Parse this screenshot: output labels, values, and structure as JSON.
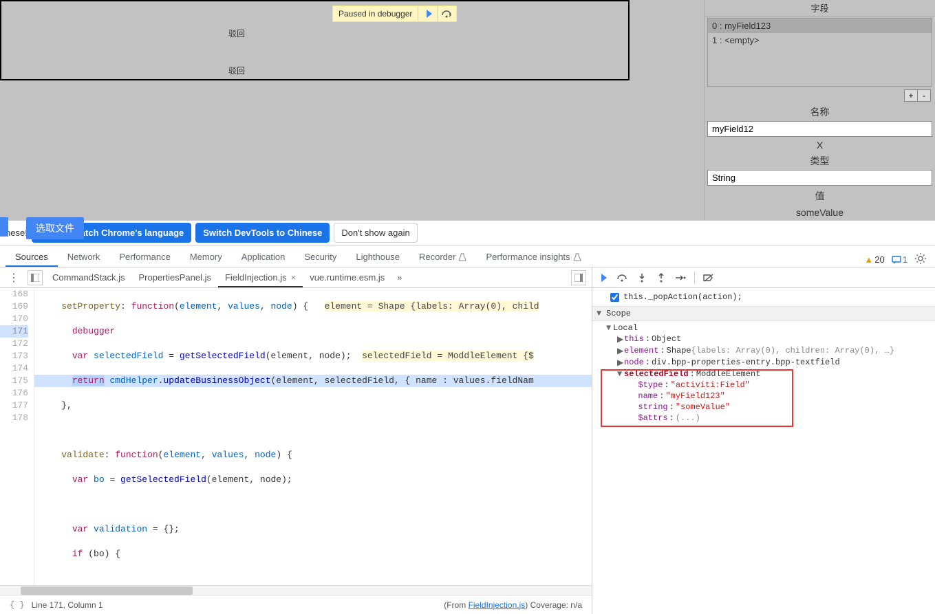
{
  "app": {
    "paused_text": "Paused in debugger",
    "lane1": "驳回",
    "lane2": "驳回",
    "choose_file": "选取文件",
    "fields_header": "字段",
    "list_items": [
      "0 : myField123",
      "1 : <empty>"
    ],
    "add": "+",
    "remove": "-",
    "name_label": "名称",
    "name_value": "myField12",
    "x_label": "X",
    "type_label": "类型",
    "type_value": "String",
    "value_label": "值",
    "value_value": "someValue"
  },
  "infobar": {
    "pre": "nese!",
    "always_match": "Always match Chrome's language",
    "switch": "Switch DevTools to Chinese",
    "dont_show": "Don't show again"
  },
  "tabs": {
    "sources": "Sources",
    "network": "Network",
    "performance": "Performance",
    "memory": "Memory",
    "application": "Application",
    "security": "Security",
    "lighthouse": "Lighthouse",
    "recorder": "Recorder",
    "insights": "Performance insights",
    "warn_count": "20",
    "msg_count": "1"
  },
  "files": {
    "f1": "CommandStack.js",
    "f2": "PropertiesPanel.js",
    "f3": "FieldInjection.js",
    "f4": "vue.runtime.esm.js"
  },
  "code": {
    "l168": "    setProperty: function(element, values, node) {   element = Shape {labels: Array(0), child",
    "l169": "      debugger",
    "l170a": "      var selectedField = getSelectedField(element, node);  ",
    "l170b": "selectedField = ModdleElement {$",
    "l171a": "      return ",
    "l171b": "cmdHelper.updateBusinessObject(element, selectedField, { name : values.fieldNam",
    "l172": "    },",
    "l173": "",
    "l174": "    validate: function(element, values, node) {",
    "l175": "      var bo = getSelectedField(element, node);",
    "l176": "",
    "l177": "      var validation = {};",
    "l178": "      if (bo) {"
  },
  "status": {
    "line_col": "Line 171, Column 1",
    "from_label": "(From ",
    "from_file": "FieldInjection.js",
    "coverage": ") Coverage: n/a"
  },
  "debug": {
    "pop_action": "this._popAction(action);",
    "scope": "Scope",
    "local": "Local",
    "this_k": "this",
    "this_v": "Object",
    "element_k": "element",
    "element_v": "Shape {labels: Array(0), children: Array(0), …}",
    "node_k": "node",
    "node_v": "div.bpp-properties-entry.bpp-textfield",
    "sel_k": "selectedField",
    "sel_v": "ModdleElement",
    "type_k": "$type",
    "type_v": "\"activiti:Field\"",
    "name_k": "name",
    "name_v": "\"myField123\"",
    "string_k": "string",
    "string_v": "\"someValue\"",
    "attrs_k": "$attrs",
    "attrs_v": "(...)"
  }
}
